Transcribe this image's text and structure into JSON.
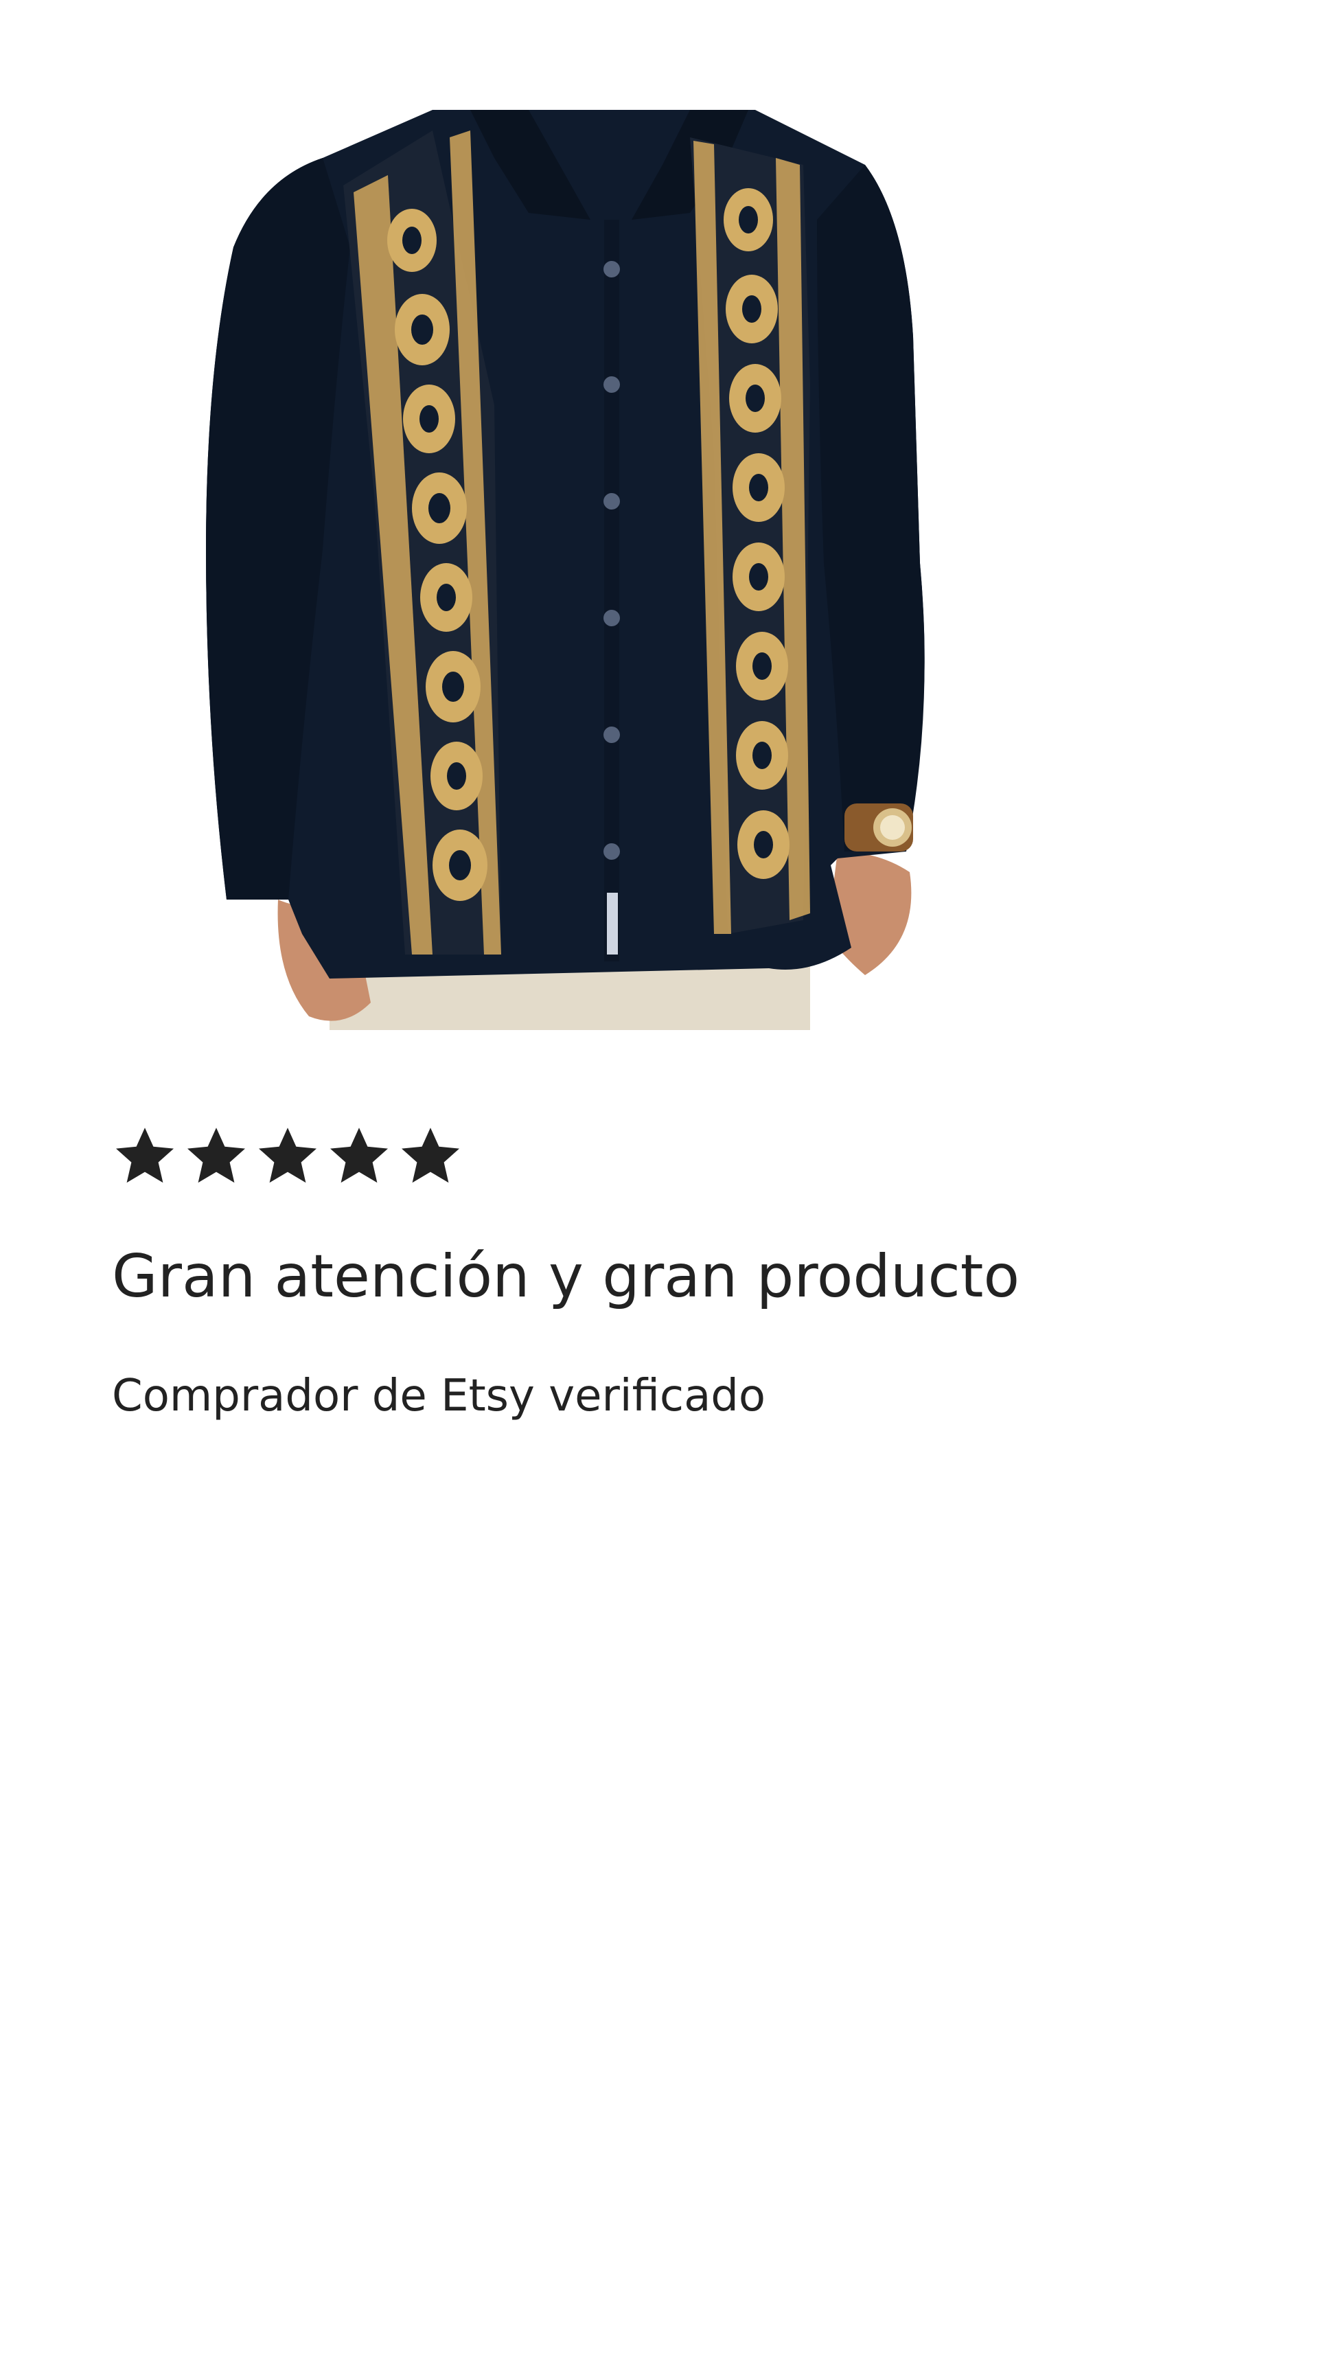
{
  "product": {
    "image_alt": "Embroidered navy long-sleeve guayabera shirt with gold vertical panels"
  },
  "review": {
    "rating": 5,
    "rating_max": 5,
    "title": "Gran atención y gran producto",
    "reviewer": "Comprador de Etsy verificado"
  },
  "icons": {
    "star": "star-icon"
  },
  "colors": {
    "text": "#222222",
    "shirt_navy": "#0f1b2d",
    "embroidery_gold": "#c8a05a",
    "background": "#ffffff"
  }
}
